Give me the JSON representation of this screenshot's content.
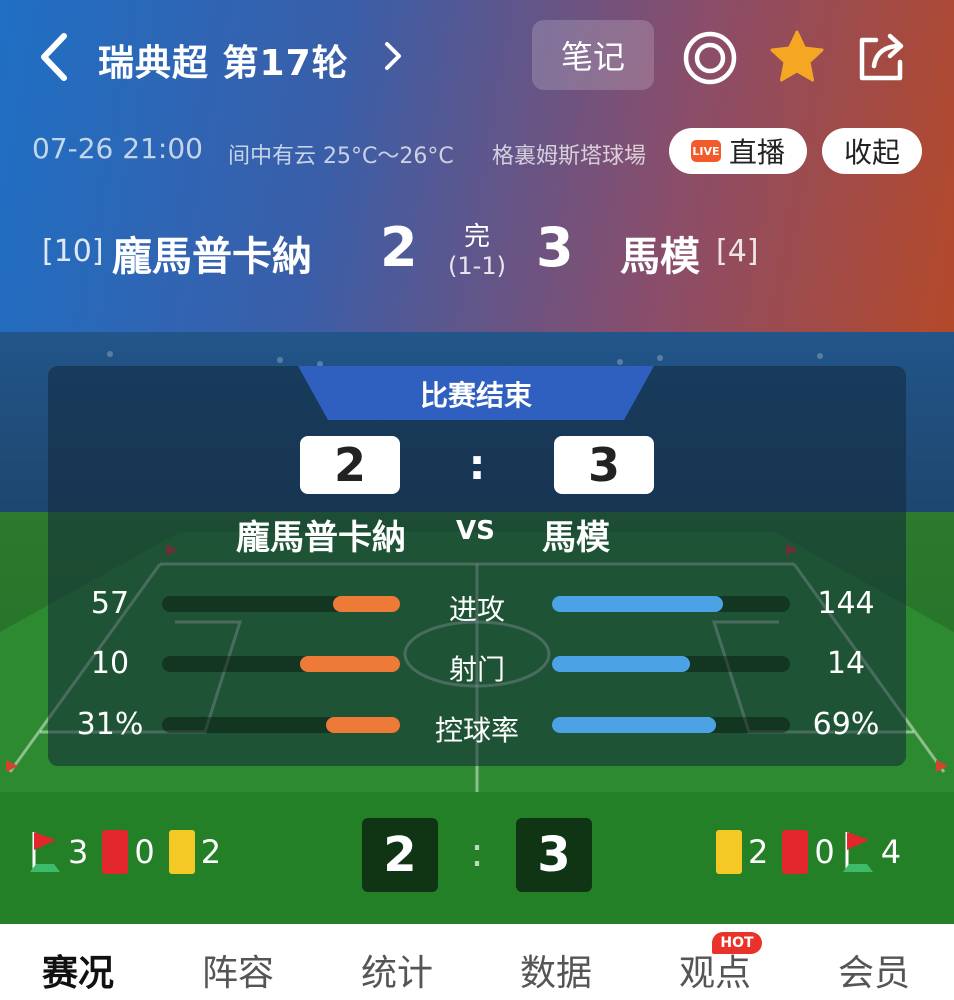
{
  "header": {
    "title": "瑞典超 第17轮",
    "notes_label": "笔记",
    "datetime": "07-26 21:00",
    "weather": "间中有云 25°C～26°C",
    "venue": "格裏姆斯塔球場",
    "live_label": "直播",
    "live_badge": "LIVE",
    "collapse_label": "收起",
    "home_rank": "[10]",
    "home_team": "龐馬普卡納",
    "home_score": "2",
    "status": "完",
    "half_time": "(1-1)",
    "away_score": "3",
    "away_team": "馬模",
    "away_rank": "[4]"
  },
  "board": {
    "banner": "比赛结束",
    "home_score": "2",
    "colon": ":",
    "away_score": "3",
    "home_team": "龐馬普卡納",
    "vs": "VS",
    "away_team": "馬模",
    "stats": [
      {
        "label": "进攻",
        "home": "57",
        "away": "144",
        "home_frac": 0.28,
        "away_frac": 0.72
      },
      {
        "label": "射门",
        "home": "10",
        "away": "14",
        "home_frac": 0.42,
        "away_frac": 0.58
      },
      {
        "label": "控球率",
        "home": "31%",
        "away": "69%",
        "home_frac": 0.31,
        "away_frac": 0.69
      }
    ]
  },
  "summary": {
    "home_corners": "3",
    "home_red": "0",
    "home_yellow": "2",
    "home_score": "2",
    "colon": ":",
    "away_score": "3",
    "away_yellow": "2",
    "away_red": "0",
    "away_corners": "4"
  },
  "tabs": [
    {
      "label": "赛况"
    },
    {
      "label": "阵容"
    },
    {
      "label": "统计"
    },
    {
      "label": "数据"
    },
    {
      "label": "观点",
      "badge": "HOT"
    },
    {
      "label": "会员"
    }
  ],
  "colors": {
    "home_bar": "#ee7a38",
    "away_bar": "#4ba3e6",
    "star": "#f5a623",
    "hot": "#e8322a"
  }
}
